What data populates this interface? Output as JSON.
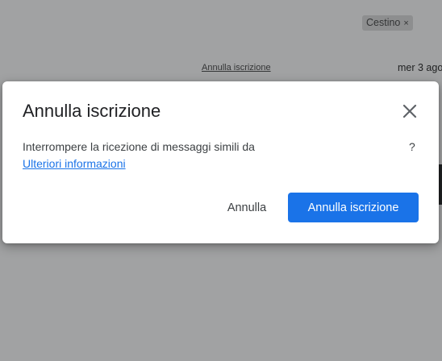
{
  "background": {
    "chip_label": "Cestino",
    "chip_close_glyph": "×",
    "unsubscribe_link": "Annulla iscrizione",
    "date": "mer 3 ago"
  },
  "dialog": {
    "title": "Annulla iscrizione",
    "close_icon": "close-icon",
    "body_text": "Interrompere la ricezione di messaggi simili da",
    "body_suffix": "?",
    "more_info_link": "Ulteriori informazioni",
    "cancel_label": "Annulla",
    "confirm_label": "Annulla iscrizione"
  },
  "colors": {
    "primary": "#1a73e8",
    "title_text": "#202124",
    "body_text": "#3c4043",
    "scrim": "rgba(32,33,36,0.42)"
  }
}
